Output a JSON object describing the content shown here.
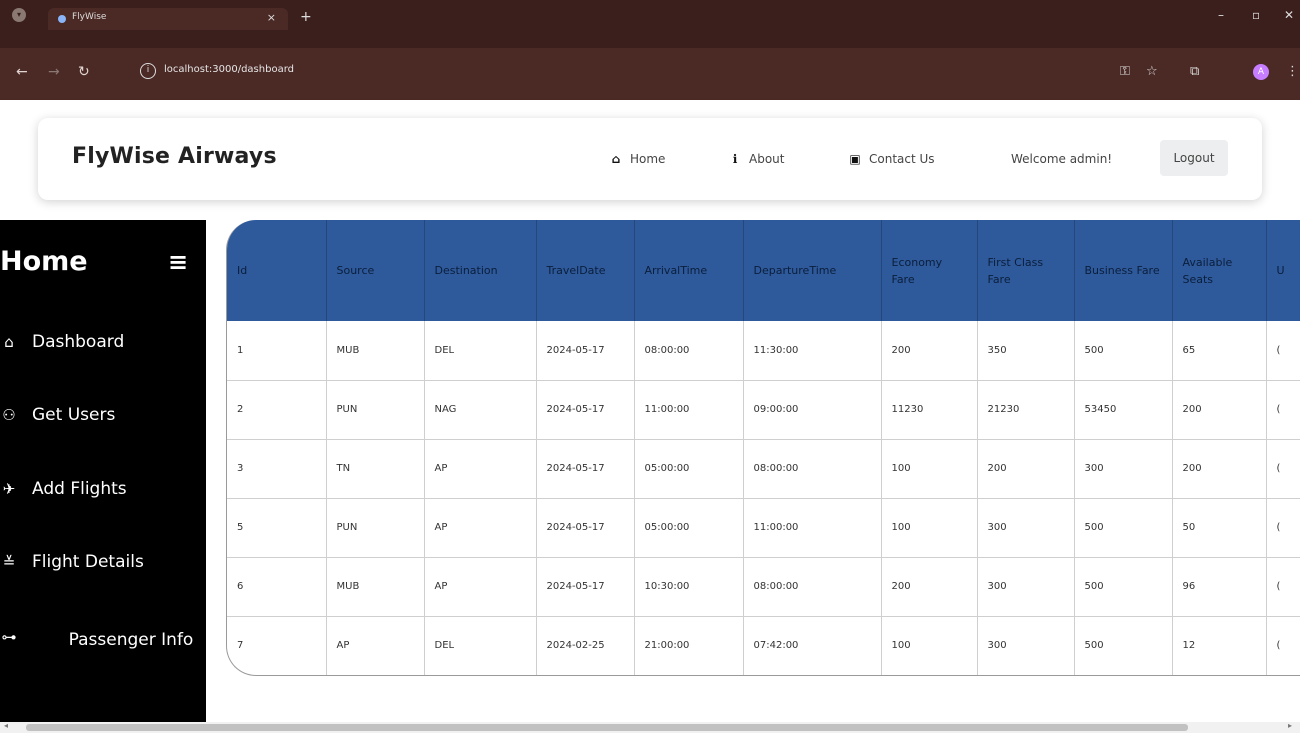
{
  "browser": {
    "tab_title": "FlyWise",
    "tab_close": "×",
    "new_tab": "+",
    "url": "localhost:3000/dashboard",
    "avatar_letter": "A"
  },
  "navbar": {
    "brand": "FlyWise Airways",
    "links": [
      {
        "label": "Home",
        "icon": "home-icon"
      },
      {
        "label": "About",
        "icon": "info-icon"
      },
      {
        "label": "Contact Us",
        "icon": "contact-icon"
      }
    ],
    "welcome": "Welcome admin!",
    "logout": "Logout"
  },
  "sidebar": {
    "title": "Home",
    "items": [
      {
        "label": "Dashboard",
        "icon": "dashboard-icon"
      },
      {
        "label": "Get Users",
        "icon": "users-icon"
      },
      {
        "label": "Add Flights",
        "icon": "plane-icon"
      },
      {
        "label": "Flight Details",
        "icon": "flight-departure-icon"
      },
      {
        "label": "Passenger Info",
        "icon": "passenger-icon"
      }
    ]
  },
  "table": {
    "headers": [
      "Id",
      "Source",
      "Destination",
      "TravelDate",
      "ArrivalTime",
      "DepartureTime",
      "Economy Fare",
      "First Class Fare",
      "Business Fare",
      "Available Seats",
      "U"
    ],
    "rows": [
      [
        "1",
        "MUB",
        "DEL",
        "2024-05-17",
        "08:00:00",
        "11:30:00",
        "200",
        "350",
        "500",
        "65",
        "("
      ],
      [
        "2",
        "PUN",
        "NAG",
        "2024-05-17",
        "11:00:00",
        "09:00:00",
        "11230",
        "21230",
        "53450",
        "200",
        "("
      ],
      [
        "3",
        "TN",
        "AP",
        "2024-05-17",
        "05:00:00",
        "08:00:00",
        "100",
        "200",
        "300",
        "200",
        "("
      ],
      [
        "5",
        "PUN",
        "AP",
        "2024-05-17",
        "05:00:00",
        "11:00:00",
        "100",
        "300",
        "500",
        "50",
        "("
      ],
      [
        "6",
        "MUB",
        "AP",
        "2024-05-17",
        "10:30:00",
        "08:00:00",
        "200",
        "300",
        "500",
        "96",
        "("
      ],
      [
        "7",
        "AP",
        "DEL",
        "2024-02-25",
        "21:00:00",
        "07:42:00",
        "100",
        "300",
        "500",
        "12",
        "("
      ]
    ]
  },
  "colors": {
    "header_bg": "#2e5a9b",
    "sidebar_bg": "#000000",
    "browser_bg": "#3a1f1c"
  }
}
